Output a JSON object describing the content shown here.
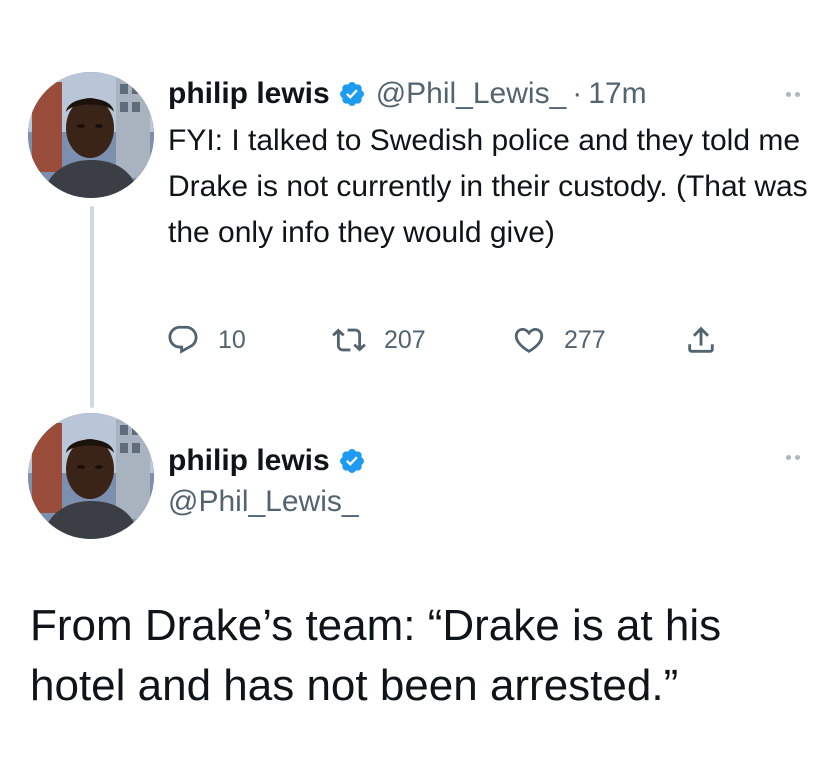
{
  "tweet1": {
    "author_name": "philip lewis",
    "handle": "@Phil_Lewis_",
    "separator": "·",
    "time": "17m",
    "text": "FYI: I talked to Swedish police and they told me Drake is not currently in their custody. (That was the only info they would give)",
    "replies": "10",
    "retweets": "207",
    "likes": "277",
    "icons": [
      "verified-badge-icon",
      "reply-icon",
      "retweet-icon",
      "like-icon",
      "share-icon",
      "more-options-icon"
    ]
  },
  "tweet2": {
    "author_name": "philip lewis",
    "handle": "@Phil_Lewis_",
    "text": "From Drake’s team: “Drake is at his hotel and has not been arrested.”"
  },
  "colors": {
    "text": "#0f1419",
    "secondary": "#536471",
    "verified": "#1d9bf0",
    "thread_line": "#cfd9de"
  }
}
